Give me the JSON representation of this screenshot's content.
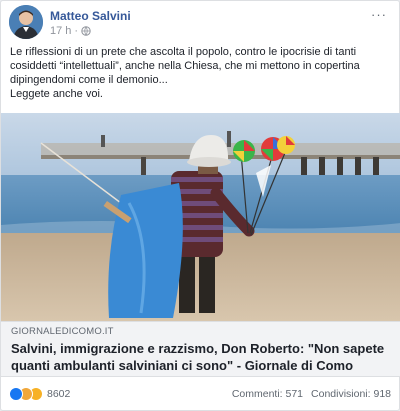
{
  "post": {
    "author": "Matteo Salvini",
    "time": "17 h",
    "more_label": "···",
    "text_lines": [
      "Le riflessioni di un prete che ascolta il popolo, contro le ipocrisie di tanti",
      "cosiddetti “intellettuali”, anche nella Chiesa, che mi mettono in copertina",
      "dipingendomi come il demonio...",
      "Leggete anche voi."
    ]
  },
  "link": {
    "domain": "GIORNALEDICOMO.IT",
    "headline": "Salvini, immigrazione e razzismo, Don Roberto: \"Non sapete quanti ambulanti salviniani ci sono\" - Giornale di Como"
  },
  "footer": {
    "reaction_count": "8602",
    "comments": "Commenti: 571",
    "shares": "Condivisioni: 918"
  },
  "colors": {
    "author": "#365899",
    "sky": "#b8cbe0",
    "sea": "#5a8fb8",
    "sand": "#cdb89b",
    "bag": "#3d8fd6"
  }
}
